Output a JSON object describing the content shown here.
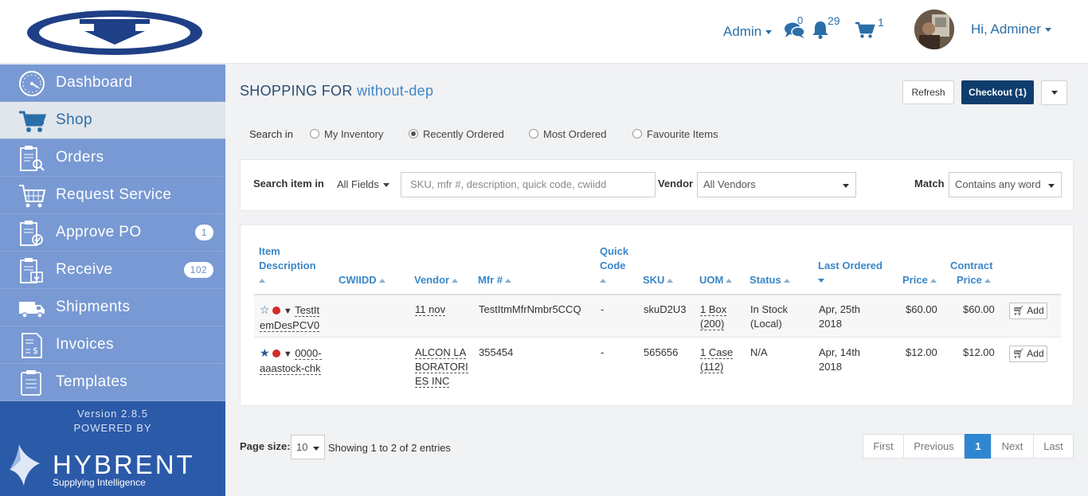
{
  "header": {
    "admin_menu": "Admin",
    "messages_count": "0",
    "notifications_count": "29",
    "cart_count": "1",
    "greeting": "Hi, Adminer"
  },
  "sidebar": {
    "items": [
      {
        "label": "Dashboard",
        "icon": "dashboard-gauge-icon"
      },
      {
        "label": "Shop",
        "icon": "cart-icon",
        "active": true
      },
      {
        "label": "Orders",
        "icon": "orders-clipboard-icon"
      },
      {
        "label": "Request Service",
        "icon": "request-service-icon"
      },
      {
        "label": "Approve PO",
        "icon": "approve-clipboard-icon",
        "badge": "1"
      },
      {
        "label": "Receive",
        "icon": "receive-clipboard-icon",
        "badge": "102"
      },
      {
        "label": "Shipments",
        "icon": "truck-icon"
      },
      {
        "label": "Invoices",
        "icon": "invoice-icon"
      },
      {
        "label": "Templates",
        "icon": "templates-clipboard-icon"
      }
    ],
    "version": "Version 2.8.5",
    "powered_by": "POWERED BY",
    "brand": "HYBRENT",
    "tagline": "Supplying Intelligence"
  },
  "page": {
    "title_prefix": "SHOPPING FOR",
    "department": "without-dep",
    "refresh_label": "Refresh",
    "checkout_label": "Checkout (1)"
  },
  "search_in": {
    "label": "Search in",
    "options": [
      "My Inventory",
      "Recently Ordered",
      "Most Ordered",
      "Favourite Items"
    ],
    "selected": "Recently Ordered"
  },
  "filters": {
    "search_item_label": "Search item in",
    "fields_value": "All Fields",
    "search_placeholder": "SKU, mfr #, description, quick code, cwiidd",
    "vendor_label": "Vendor",
    "vendor_value": "All Vendors",
    "match_label": "Match",
    "match_value": "Contains any word"
  },
  "table": {
    "headers": {
      "item_l1": "Item",
      "item_l2": "Description",
      "cwiidd": "CWIIDD",
      "vendor": "Vendor",
      "mfr": "Mfr #",
      "quick_l1": "Quick",
      "quick_l2": "Code",
      "sku": "SKU",
      "uom": "UOM",
      "status": "Status",
      "last_ordered": "Last Ordered",
      "price": "Price",
      "contract_l1": "Contract",
      "contract_l2": "Price"
    },
    "rows": [
      {
        "desc_l1": "TestIt",
        "desc_l2": "emDesPCV0",
        "vendor_l1": "11 nov",
        "mfr": "TestItmMfrNmbr5CCQ",
        "quick_code": "-",
        "sku": "skuD2U3",
        "uom_l1": "1 Box",
        "uom_l2": "(200)",
        "status_l1": "In Stock",
        "status_l2": "(Local)",
        "last_l1": "Apr, 25th",
        "last_l2": "2018",
        "price": "$60.00",
        "contract_price": "$60.00",
        "add_label": "Add",
        "favourite": false
      },
      {
        "desc_l1": "0000-",
        "desc_l2": "aaastock-chk",
        "vendor_l1": "ALCON LA",
        "vendor_l2": "BORATORI",
        "vendor_l3": "ES INC",
        "mfr": "355454",
        "quick_code": "-",
        "sku": "565656",
        "uom_l1": "1 Case",
        "uom_l2": "(112)",
        "status_l1": "N/A",
        "last_l1": "Apr, 14th",
        "last_l2": "2018",
        "price": "$12.00",
        "contract_price": "$12.00",
        "add_label": "Add",
        "favourite": true
      }
    ]
  },
  "pagination": {
    "page_size_label": "Page size:",
    "page_size": "10",
    "showing": "Showing 1 to 2 of 2 entries",
    "first": "First",
    "previous": "Previous",
    "current": "1",
    "next": "Next",
    "last": "Last"
  },
  "colors": {
    "sidebar": "#7899d3",
    "sidebar_footer": "#2b5aa8",
    "accent": "#2a6fa8",
    "checkout": "#0f3d6d",
    "active_page": "#2f86d0"
  }
}
